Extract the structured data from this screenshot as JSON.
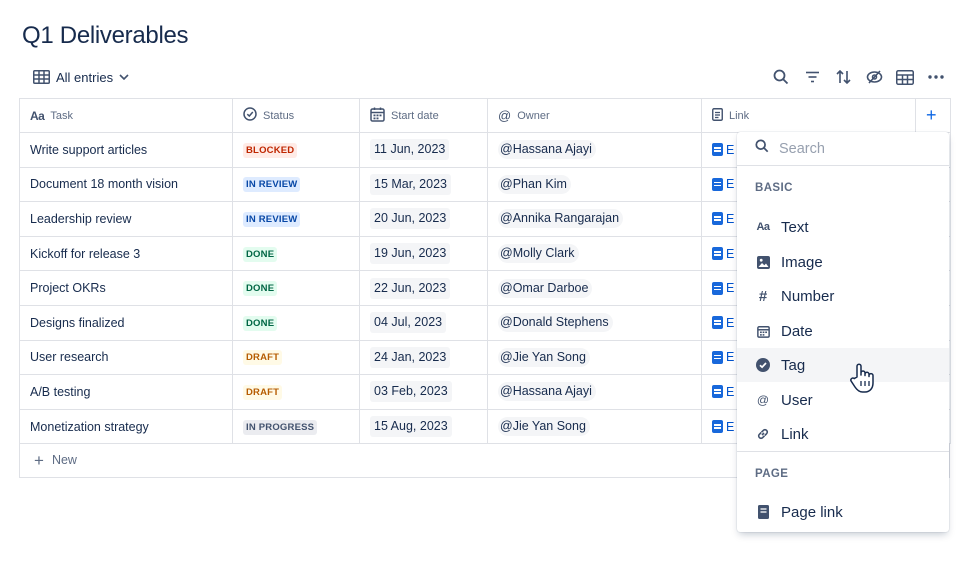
{
  "page": {
    "title": "Q1 Deliverables"
  },
  "view": {
    "label": "All entries"
  },
  "columns": {
    "task": "Task",
    "status": "Status",
    "start": "Start date",
    "owner": "Owner",
    "link": "Link",
    "task_icon": "Aa"
  },
  "rows": [
    {
      "task": "Write support articles",
      "status": "BLOCKED",
      "date": "11 Jun, 2023",
      "owner": "Hassana Ajayi",
      "link": "E"
    },
    {
      "task": "Document 18 month vision",
      "status": "IN REVIEW",
      "date": "15 Mar, 2023",
      "owner": "Phan Kim",
      "link": "E"
    },
    {
      "task": "Leadership review",
      "status": "IN REVIEW",
      "date": "20 Jun, 2023",
      "owner": "Annika Rangarajan",
      "link": "E"
    },
    {
      "task": "Kickoff for release 3",
      "status": "DONE",
      "date": "19 Jun, 2023",
      "owner": "Molly Clark",
      "link": "E"
    },
    {
      "task": "Project OKRs",
      "status": "DONE",
      "date": "22 Jun, 2023",
      "owner": "Omar Darboe",
      "link": "E"
    },
    {
      "task": "Designs finalized",
      "status": "DONE",
      "date": "04 Jul, 2023",
      "owner": "Donald Stephens",
      "link": "E"
    },
    {
      "task": "User research",
      "status": "DRAFT",
      "date": "24 Jan, 2023",
      "owner": "Jie Yan Song",
      "link": "E"
    },
    {
      "task": "A/B testing",
      "status": "DRAFT",
      "date": "03 Feb, 2023",
      "owner": "Hassana Ajayi",
      "link": "E"
    },
    {
      "task": "Monetization strategy",
      "status": "IN PROGRESS",
      "date": "15 Aug, 2023",
      "owner": "Jie Yan Song",
      "link": "E"
    }
  ],
  "status_colors": {
    "BLOCKED": {
      "bg": "#ffebe6",
      "fg": "#bf2600"
    },
    "IN REVIEW": {
      "bg": "#deebff",
      "fg": "#0747a6"
    },
    "DONE": {
      "bg": "#e3fcef",
      "fg": "#006644"
    },
    "DRAFT": {
      "bg": "#fffae6",
      "fg": "#b65c02"
    },
    "IN PROGRESS": {
      "bg": "#ebecf0",
      "fg": "#42526e"
    }
  },
  "new_row": {
    "plus": "+",
    "label": "New"
  },
  "add_column": {
    "label": "+"
  },
  "mention_prefix": "@",
  "menu": {
    "search_placeholder": "Search",
    "section_basic": "BASIC",
    "section_page": "PAGE",
    "items": [
      {
        "label": "Text",
        "icon": "text-icon"
      },
      {
        "label": "Image",
        "icon": "image-icon"
      },
      {
        "label": "Number",
        "icon": "number-icon"
      },
      {
        "label": "Date",
        "icon": "calendar-icon"
      },
      {
        "label": "Tag",
        "icon": "tag-icon"
      },
      {
        "label": "User",
        "icon": "at-icon"
      },
      {
        "label": "Link",
        "icon": "link-icon"
      }
    ],
    "page_items": [
      {
        "label": "Page link",
        "icon": "page-icon"
      }
    ],
    "text_icon": "Aa",
    "number_icon": "#",
    "user_icon": "@"
  },
  "colors": {
    "accent": "#0c66e4",
    "text": "#172b4d",
    "muted": "#5e6c84",
    "border": "#dfe1e6"
  }
}
